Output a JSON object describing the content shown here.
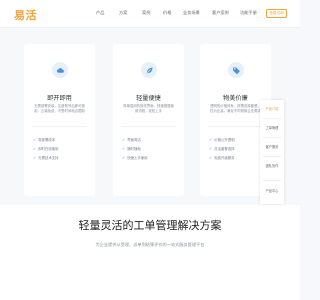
{
  "brand": {
    "logo_text": "易活",
    "accent_color": "#f2a33a",
    "icon_color": "#4a90e2"
  },
  "nav": {
    "items": [
      "产品",
      "方案",
      "案例",
      "价格",
      "业务场景",
      "客户案例",
      "功能手册"
    ],
    "cta_label": "免费试用"
  },
  "cards": [
    {
      "icon": "cloud-icon",
      "title": "即开即用",
      "description": "无需部署安装，注册账号后即可使用，云端免费，不受时间地点限制",
      "features": [
        "零部署成本",
        "即时在线使用",
        "无需技术支持"
      ]
    },
    {
      "icon": "leaf-icon",
      "title": "轻量便捷",
      "description": "简单易用的操作界面，快速搭建使用流程，轻松上手",
      "features": [
        "界面简洁",
        "随时随地",
        "快速上手使用"
      ]
    },
    {
      "icon": "tag-icon",
      "title": "物美价廉",
      "description": "透明的价格体系，按需选择套餐，性价比高，满足不同规模企业需求",
      "features": [
        "价格公开透明",
        "灵活套餐选择",
        "免费升级服务"
      ]
    }
  ],
  "side_panel": {
    "items": [
      "产品介绍",
      "工单管理",
      "客户服务",
      "团队协作",
      "产品中心"
    ]
  },
  "bottom": {
    "title": "轻量灵活的工单管理解决方案",
    "description": "为企业提供从受理、派单到结果评价的一站式服务管理平台"
  }
}
